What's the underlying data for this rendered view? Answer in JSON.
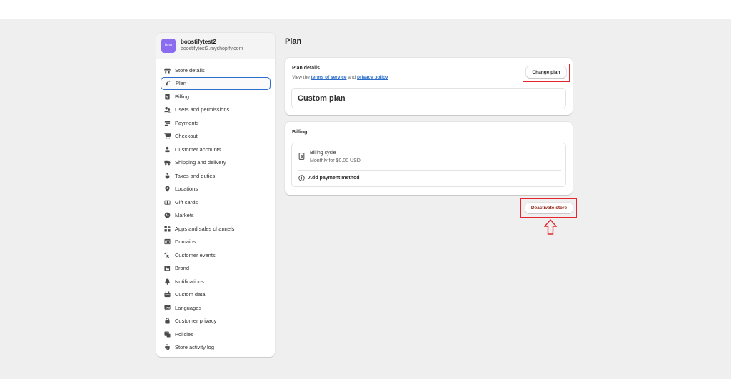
{
  "store": {
    "avatar_text": "boo",
    "name": "boostifytest2",
    "domain": "boostifytest2.myshopify.com",
    "avatar_color": "#8b6cf0"
  },
  "sidebar": {
    "items": [
      {
        "label": "Store details",
        "icon": "store-icon"
      },
      {
        "label": "Plan",
        "icon": "plan-icon",
        "active": true
      },
      {
        "label": "Billing",
        "icon": "billing-icon"
      },
      {
        "label": "Users and permissions",
        "icon": "users-icon"
      },
      {
        "label": "Payments",
        "icon": "payments-icon"
      },
      {
        "label": "Checkout",
        "icon": "cart-icon"
      },
      {
        "label": "Customer accounts",
        "icon": "person-icon"
      },
      {
        "label": "Shipping and delivery",
        "icon": "truck-icon"
      },
      {
        "label": "Taxes and duties",
        "icon": "tax-bag-icon"
      },
      {
        "label": "Locations",
        "icon": "location-pin-icon"
      },
      {
        "label": "Gift cards",
        "icon": "gift-card-icon"
      },
      {
        "label": "Markets",
        "icon": "globe-icon"
      },
      {
        "label": "Apps and sales channels",
        "icon": "apps-icon"
      },
      {
        "label": "Domains",
        "icon": "domain-icon"
      },
      {
        "label": "Customer events",
        "icon": "cursor-click-icon"
      },
      {
        "label": "Brand",
        "icon": "brand-icon"
      },
      {
        "label": "Notifications",
        "icon": "bell-icon"
      },
      {
        "label": "Custom data",
        "icon": "custom-data-icon"
      },
      {
        "label": "Languages",
        "icon": "language-icon"
      },
      {
        "label": "Customer privacy",
        "icon": "lock-icon"
      },
      {
        "label": "Policies",
        "icon": "policy-icon"
      },
      {
        "label": "Store activity log",
        "icon": "activity-log-icon"
      }
    ]
  },
  "main": {
    "title": "Plan",
    "plan_details": {
      "title": "Plan details",
      "sub_prefix": "View the ",
      "terms_link": "terms of service",
      "sub_middle": " and ",
      "privacy_link": "privacy policy",
      "change_plan_label": "Change plan",
      "plan_name": "Custom plan"
    },
    "billing": {
      "title": "Billing",
      "cycle_title": "Billing cycle",
      "cycle_value": "Monthly for $0.00 USD",
      "add_payment_label": "Add payment method"
    },
    "deactivate_label": "Deactivate store"
  },
  "colors": {
    "accent_link": "#2c6ecb",
    "highlight": "#e5262f",
    "danger_text": "#8e1f0b"
  }
}
